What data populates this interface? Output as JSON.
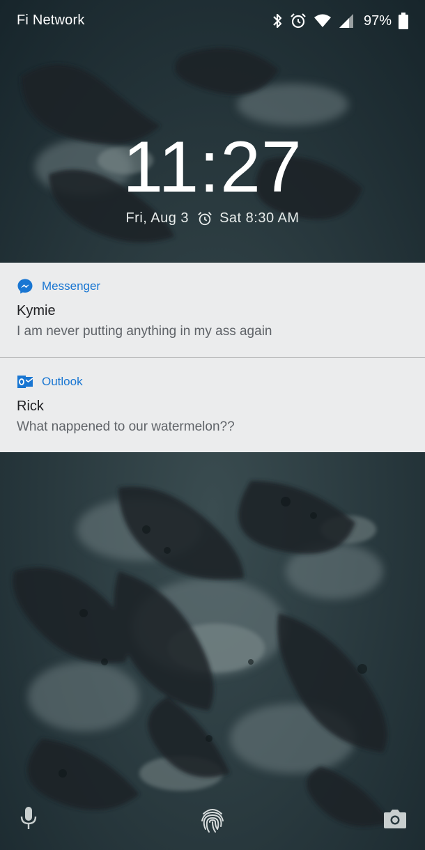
{
  "status_bar": {
    "carrier": "Fi Network",
    "battery_percent": "97%",
    "icons": [
      "bluetooth-icon",
      "alarm-icon",
      "wifi-icon",
      "cell-signal-icon",
      "battery-icon"
    ]
  },
  "lockscreen": {
    "time": "11:27",
    "date": "Fri, Aug 3",
    "next_alarm": "Sat 8:30 AM"
  },
  "notifications": [
    {
      "app": "Messenger",
      "icon": "messenger-icon",
      "title": "Kymie",
      "body": "I am never putting anything in my ass again"
    },
    {
      "app": "Outlook",
      "icon": "outlook-icon",
      "title": "Rick",
      "body": "What nappened to our watermelon??"
    }
  ],
  "bottom_bar": {
    "icons": [
      "microphone-icon",
      "fingerprint-icon",
      "camera-icon"
    ]
  },
  "colors": {
    "notification_bg": "#ebeced",
    "app_name": "#1976d2",
    "wallpaper_dark": "#1c2b30"
  }
}
